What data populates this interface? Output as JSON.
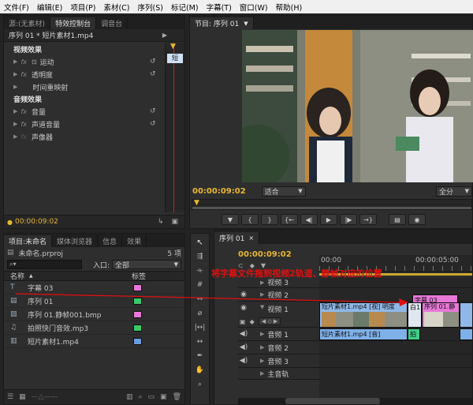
{
  "menu": [
    "文件(F)",
    "编辑(E)",
    "项目(P)",
    "素材(C)",
    "序列(S)",
    "标记(M)",
    "字幕(T)",
    "窗口(W)",
    "帮助(H)"
  ],
  "source_panel": {
    "tabs": [
      "源:(无素材)",
      "特效控制台",
      "调音台"
    ],
    "clip_path": "序列 01 * 短片素材1.mp4",
    "mini_clip_label": "短",
    "video_effects_header": "视频效果",
    "effects": [
      {
        "label": "运动",
        "has_reset": true
      },
      {
        "label": "透明度",
        "has_reset": true
      },
      {
        "label": "时间重映射",
        "has_reset": false
      }
    ],
    "audio_effects_header": "音频效果",
    "audio_effects": [
      {
        "label": "音量",
        "has_reset": true
      },
      {
        "label": "声道音量",
        "has_reset": true
      },
      {
        "label": "声像器",
        "has_reset": false
      }
    ],
    "timecode": "00:00:09:02"
  },
  "program": {
    "title": "节目: 序列 01",
    "timecode": "00:00:09:02",
    "fit_label": "适合",
    "quality_label": "全分"
  },
  "project": {
    "tabs": [
      "项目:未命名",
      "媒体浏览器",
      "信息",
      "效果"
    ],
    "project_file": "未命名.prproj",
    "item_count": "5 项",
    "entry_label": "入口:",
    "entry_value": "全部",
    "col_name": "名称",
    "col_label": "标签",
    "items": [
      {
        "name": "字幕 03",
        "color": "#e878d8"
      },
      {
        "name": "序列 01",
        "color": "#38c96a"
      },
      {
        "name": "序列 01.静帧001.bmp",
        "color": "#e878d8"
      },
      {
        "name": "拍照快门音效.mp3",
        "color": "#38c96a"
      },
      {
        "name": "短片素材1.mp4",
        "color": "#6b9be0"
      }
    ]
  },
  "timeline": {
    "tab": "序列 01",
    "timecode": "00:00:09:02",
    "ruler": [
      "00:00",
      "00:00:05:00"
    ],
    "tracks": {
      "v3": "视频 3",
      "v2": "视频 2",
      "v1": "视频 1",
      "a1": "音频 1",
      "a2": "音频 2",
      "a3": "音频 3",
      "master": "主音轨"
    },
    "clips": {
      "title_clip": "字幕 03",
      "video_main": "短片素材1.mp4 [视] 明度",
      "video_white": "白1",
      "video_seq": "序列 01.静",
      "audio_main": "短片素材1.mp4 [音]",
      "audio_shutter": "拍"
    },
    "annotation": "将字幕文件拖到视频2轨道、静帧对应的位置"
  },
  "colors": {
    "accent_timecode": "#e8b830",
    "annotation_red": "#e01010",
    "title_clip": "#e878d8",
    "video_clip": "#8fb8e8",
    "audio_clip": "#7fb0e8",
    "shutter_clip": "#3fcf85"
  }
}
